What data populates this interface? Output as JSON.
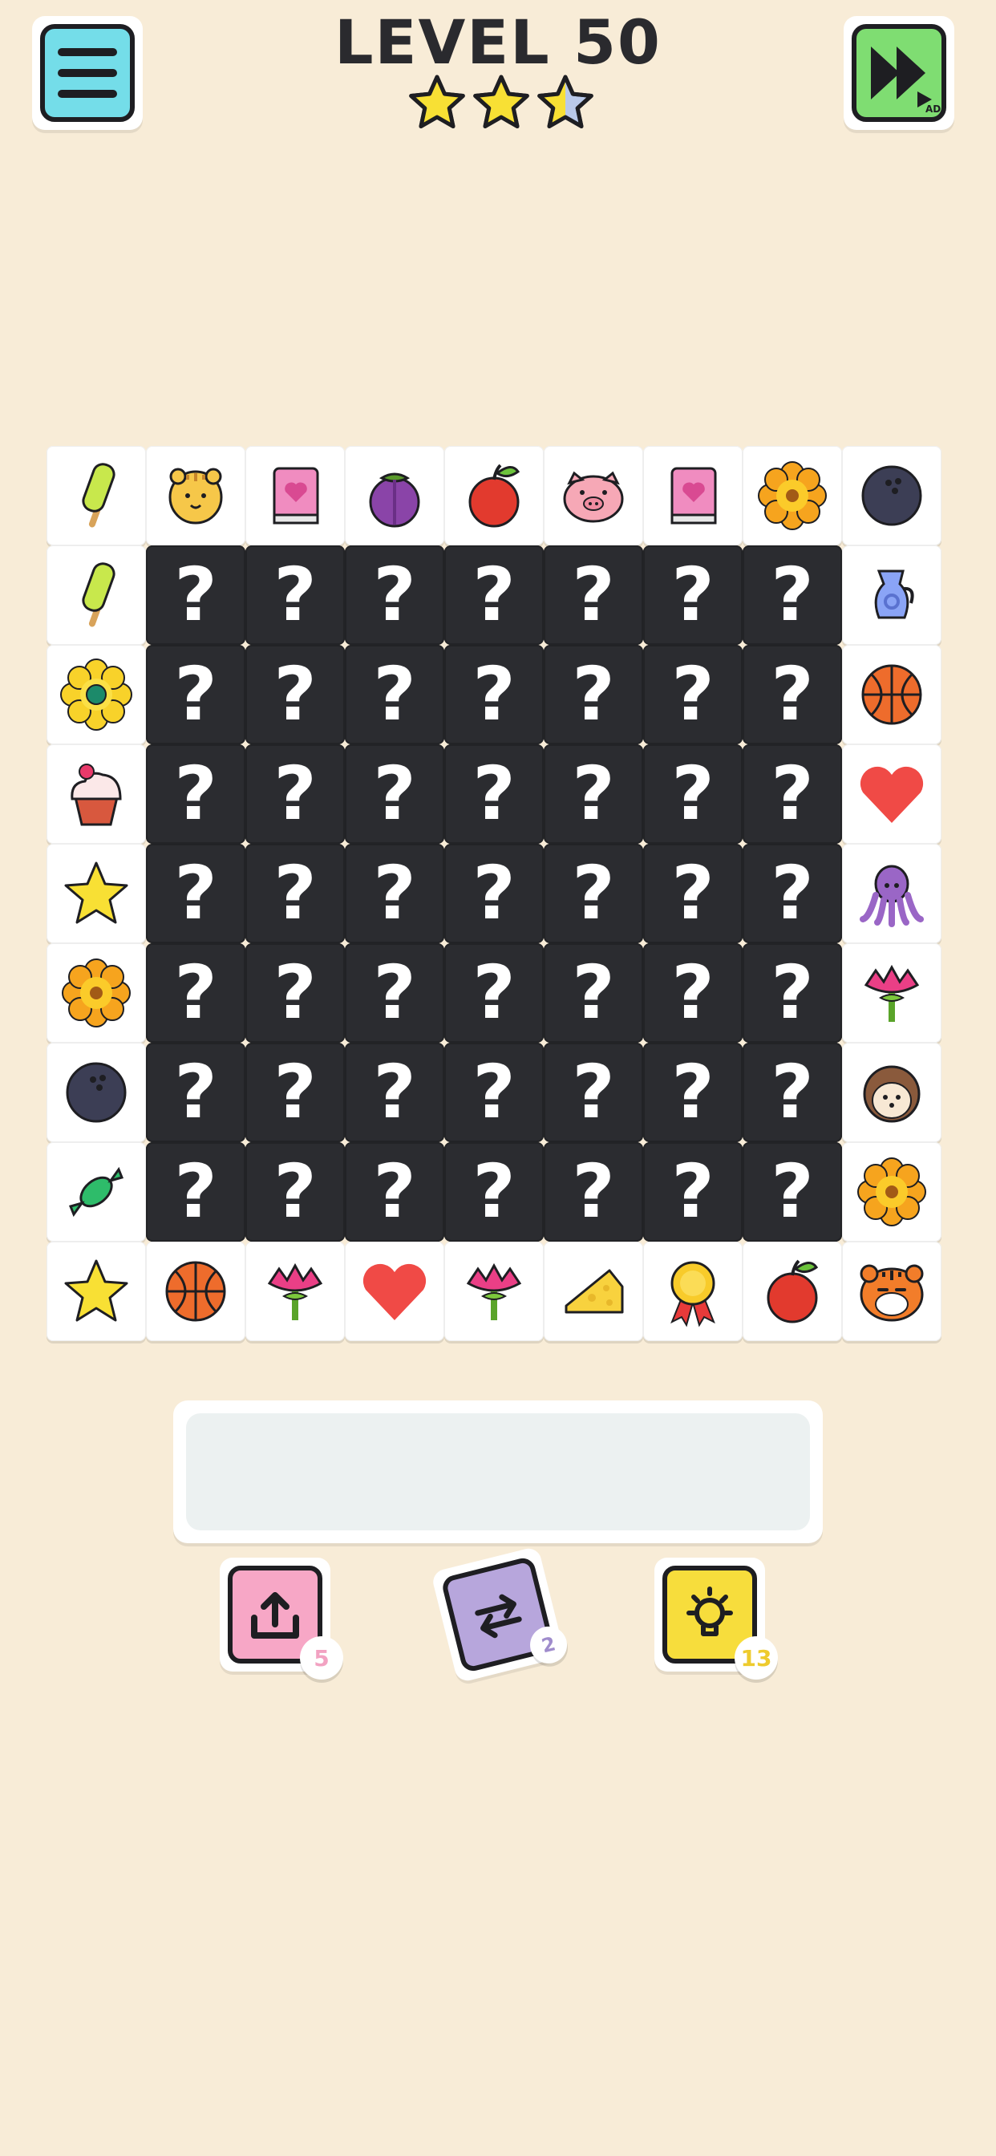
{
  "header": {
    "title": "LEVEL 50",
    "stars_earned": 2.5,
    "stars_total": 3,
    "menu_icon": "hamburger-icon",
    "skip_icon": "fast-forward-icon",
    "skip_badge": "AD"
  },
  "board": {
    "rows": [
      [
        "popsicle",
        "tiger",
        "book",
        "mangosteen",
        "apple",
        "pig",
        "book",
        "sunflower",
        "bowling-ball"
      ],
      [
        "popsicle",
        "?",
        "?",
        "?",
        "?",
        "?",
        "?",
        "?",
        "jug"
      ],
      [
        "daisy",
        "?",
        "?",
        "?",
        "?",
        "?",
        "?",
        "?",
        "basketball"
      ],
      [
        "cupcake",
        "?",
        "?",
        "?",
        "?",
        "?",
        "?",
        "?",
        "heart"
      ],
      [
        "star",
        "?",
        "?",
        "?",
        "?",
        "?",
        "?",
        "?",
        "octopus"
      ],
      [
        "sunflower",
        "?",
        "?",
        "?",
        "?",
        "?",
        "?",
        "?",
        "carnation"
      ],
      [
        "bowling-ball",
        "?",
        "?",
        "?",
        "?",
        "?",
        "?",
        "?",
        "hedgehog"
      ],
      [
        "candy",
        "?",
        "?",
        "?",
        "?",
        "?",
        "?",
        "?",
        "sunflower"
      ],
      [
        "star",
        "basketball",
        "carnation",
        "heart",
        "carnation",
        "cheese",
        "medal",
        "apple",
        "tiger-face"
      ]
    ],
    "hidden_symbol": "?"
  },
  "tray": {
    "slots": []
  },
  "powerups": {
    "undo": {
      "icon": "undo-arrow-icon",
      "count": "5",
      "color": "#f7a7c6",
      "badge_color": "#f2a2c2"
    },
    "shuffle": {
      "icon": "shuffle-icon",
      "count": "2",
      "color": "#b7a6dc",
      "badge_color": "#9f8ccc"
    },
    "hint": {
      "icon": "lightbulb-icon",
      "count": "13",
      "color": "#f7dd3c",
      "badge_color": "#eecb2e"
    }
  },
  "colors": {
    "background": "#f8ecd7",
    "hidden_tile": "#2b2c30",
    "menu": "#74dde9",
    "skip": "#7fdd72"
  }
}
